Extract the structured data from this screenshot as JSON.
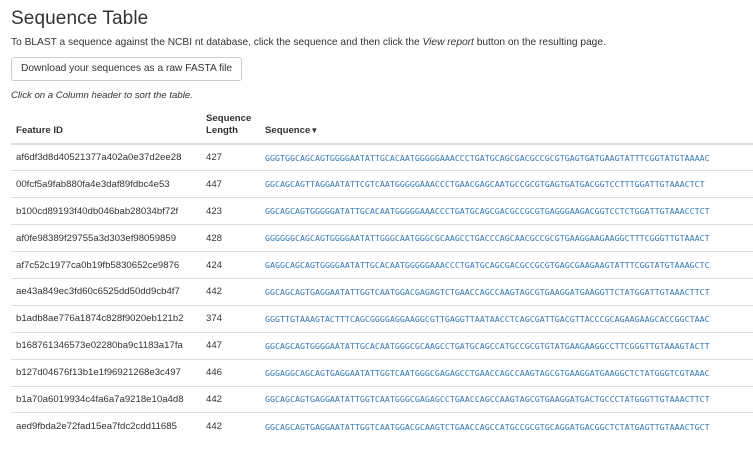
{
  "page": {
    "title": "Sequence Table",
    "intro_before": "To BLAST a sequence against the NCBI nt database, click the sequence and then click the ",
    "intro_em": "View report",
    "intro_after": " button on the resulting page.",
    "download_button": "Download your sequences as a raw FASTA file",
    "sort_hint": "Click on a Column header to sort the table."
  },
  "table": {
    "headers": {
      "feature_id": "Feature ID",
      "seq_length_line1": "Sequence",
      "seq_length_line2": "Length",
      "sequence": "Sequence",
      "sort_arrow": "▼"
    },
    "rows": [
      {
        "id": "af6df3d8d40521377a402a0e37d2ee28",
        "length": "427",
        "sequence": "GGGTGGCAGCAGTGGGGAATATTGCACAATGGGGGAAACCCTGATGCAGCGACGCCGCGTGAGTGATGAAGTATTTCGGTATGTAAAAC"
      },
      {
        "id": "00fcf5a9fab880fa4e3daf89fdbc4e53",
        "length": "447",
        "sequence": "GGCAGCAGTTAGGAATATTCGTCAATGGGGGAAACCCTGAACGAGCAATGCCGCGTGAGTGATGACGGTCCTTTGGATTGTAAACTCT"
      },
      {
        "id": "b100cd89193f40db046bab28034bf72f",
        "length": "423",
        "sequence": "GGCAGCAGTGGGGGATATTGCACAATGGGGGAAACCCTGATGCAGCGACGCCGCGTGAGGGAAGACGGTCCTCTGGATTGTAAACCTCT"
      },
      {
        "id": "af0fe98389f29755a3d303ef98059859",
        "length": "428",
        "sequence": "GGGGGGCAGCAGTGGGGAATATTGGGCAATGGGCGCAAGCCTGACCCAGCAACGCCGCGTGAAGGAAGAAGGCTTTCGGGTTGTAAACT"
      },
      {
        "id": "af7c52c1977ca0b19fb5830652ce9876",
        "length": "424",
        "sequence": "GAGGCAGCAGTGGGGAATATTGCACAATGGGGGAAACCCTGATGCAGCGACGCCGCGTGAGCGAAGAAGTATTTCGGTATGTAAAGCTC"
      },
      {
        "id": "ae43a849ec3fd60c6525dd50dd9cb4f7",
        "length": "442",
        "sequence": "GGCAGCAGTGAGGAATATTGGTCAATGGACGAGAGTCTGAACCAGCCAAGTAGCGTGAAGGATGAAGGTTCTATGGATTGTAAACTTCT"
      },
      {
        "id": "b1adb8ae776a1874c828f9020eb121b2",
        "length": "374",
        "sequence": "GGGTTGTAAAGTACTTTCAGCGGGGAGGAAGGCGTTGAGGTTAATAACCTCAGCGATTGACGTTACCCGCAGAAGAAGCACCGGCTAAC"
      },
      {
        "id": "b168761346573e02280ba9c1183a17fa",
        "length": "447",
        "sequence": "GGCAGCAGTGGGGAATATTGCACAATGGGCGCAAGCCTGATGCAGCCATGCCGCGTGTATGAAGAAGGCCTTCGGGTTGTAAAGTACTT"
      },
      {
        "id": "b127d04676f13b1e1f96921268e3c497",
        "length": "446",
        "sequence": "GGGAGGCAGCAGTGAGGAATATTGGTCAATGGGCGAGAGCCTGAACCAGCCAAGTAGCGTGAAGGATGAAGGCTCTATGGGTCGTAAAC"
      },
      {
        "id": "b1a70a6019934c4fa6a7a9218e10a4d8",
        "length": "442",
        "sequence": "GGCAGCAGTGAGGAATATTGGTCAATGGGCGAGAGCCTGAACCAGCCAAGTAGCGTGAAGGATGACTGCCCTATGGGTTGTAAACTTCT"
      },
      {
        "id": "aed9fbda2e72fad15ea7fdc2cdd11685",
        "length": "442",
        "sequence": "GGCAGCAGTGAGGAATATTGGTCAATGGACGCAAGTCTGAACCAGCCATGCCGCGTGCAGGATGACGGCTCTATGAGTTGTAAACTGCT"
      }
    ]
  },
  "colors": {
    "link": "#337ab7",
    "border": "#dddddd",
    "text": "#333333"
  }
}
